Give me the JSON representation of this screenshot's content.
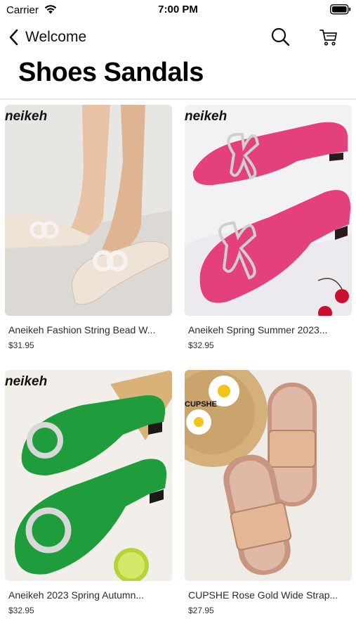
{
  "status_bar": {
    "carrier": "Carrier",
    "time": "7:00 PM"
  },
  "nav": {
    "back_label": "Welcome"
  },
  "page": {
    "title": "Shoes Sandals"
  },
  "products": [
    {
      "title": "Aneikeh Fashion String Bead W...",
      "price": "$31.95",
      "brand_mark": "neikeh",
      "shoe_color": "#efe3d6"
    },
    {
      "title": "Aneikeh Spring Summer 2023...",
      "price": "$32.95",
      "brand_mark": "neikeh",
      "shoe_color": "#e4407c"
    },
    {
      "title": "Aneikeh 2023 Spring Autumn...",
      "price": "$32.95",
      "brand_mark": "neikeh",
      "shoe_color": "#1f9d3c"
    },
    {
      "title": "CUPSHE Rose Gold Wide Strap...",
      "price": "$27.95",
      "brand_mark": "CUPSHE",
      "shoe_color": "#c89581"
    }
  ],
  "icons": {
    "back": "chevron-left-icon",
    "search": "search-icon",
    "cart": "cart-icon",
    "wifi": "wifi-icon",
    "battery": "battery-icon"
  }
}
